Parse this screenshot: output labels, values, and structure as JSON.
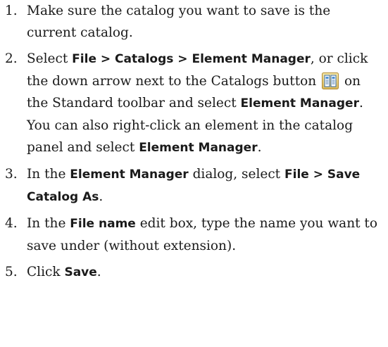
{
  "steps": [
    {
      "number": "1.",
      "text_1": "Make sure the catalog you want to save is the current catalog."
    },
    {
      "number": "2.",
      "text_1": "Select ",
      "ui_1": "File > Catalogs > Element Manager",
      "text_2": ", or click the down arrow next to the Catalogs button",
      "text_3": " on the Standard toolbar and select ",
      "ui_2": "Element Manager",
      "text_4": ". You can also right-click an element in the catalog panel and select ",
      "ui_3": "Element Manager",
      "text_5": ".",
      "icon": "catalogs-icon"
    },
    {
      "number": "3.",
      "text_1": "In the ",
      "ui_1": "Element Manager",
      "text_2": " dialog, select ",
      "ui_2": "File > Save Catalog As",
      "text_3": "."
    },
    {
      "number": "4.",
      "text_1": "In the ",
      "ui_1": "File name",
      "text_2": " edit box, type the name you want to save under (without extension)."
    },
    {
      "number": "5.",
      "text_1": "Click ",
      "ui_1": "Save",
      "text_2": "."
    }
  ]
}
